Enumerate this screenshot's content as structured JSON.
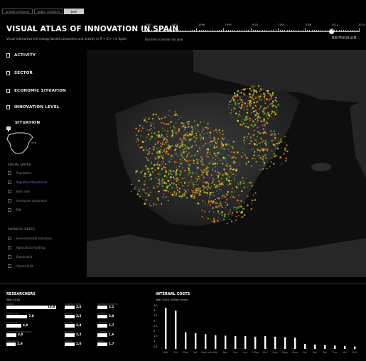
{
  "toggles": [
    {
      "label": "private company",
      "active": false
    },
    {
      "label": "public company",
      "active": false
    },
    {
      "label": "both",
      "active": true
    }
  ],
  "header": {
    "title": "VISUAL ATLAS OF INNOVATION IN SPAIN",
    "subtitle": "Visual interactive technology-based companies and activity in R + D + i in Spain"
  },
  "timeline": {
    "years": [
      "1990",
      "1993",
      "1996",
      "1999",
      "2002",
      "2005",
      "2008",
      "2011",
      "2014"
    ],
    "caption": "Business creation by year",
    "play_label": "REPRODUIR",
    "current_year": "2011"
  },
  "sidebar": {
    "categories": [
      {
        "label": "ACTIVITY",
        "icon": "checkbox-icon"
      },
      {
        "label": "SECTOR",
        "icon": "checkbox-icon"
      },
      {
        "label": "ECONOMIC SITUATION",
        "icon": "checkbox-icon"
      },
      {
        "label": "INNOVATION LEVEL",
        "icon": "checkbox-icon"
      },
      {
        "label": "SITUATION",
        "icon": "pin-icon"
      }
    ],
    "social_title": "SOCIAL DATES",
    "social": [
      "Population",
      "Migration Movements",
      "Birth rate",
      "Immigrant population",
      "PIB"
    ],
    "social_active": "Migration Movements",
    "physical_title": "PHYSICAL DATES",
    "physical": [
      "Environmental indicators",
      "Agricultural holdings",
      "Roads built",
      "Aljams built"
    ]
  },
  "researchers": {
    "title": "RESEARCHERS",
    "subtitle": "Year 2016",
    "col1": [
      {
        "name": "Madrid",
        "value": "18,8",
        "fraction": 1.0
      },
      {
        "name": "Catalunya",
        "value": "7,8",
        "fraction": 0.42
      },
      {
        "name": "Andalucia",
        "value": "4,0",
        "fraction": 0.3
      },
      {
        "name": "Comunitat Valenciana",
        "value": "3,0",
        "fraction": 0.2
      },
      {
        "name": "Pais Vasco",
        "value": "2,9",
        "fraction": 0.19
      }
    ],
    "col2": [
      {
        "name": "Castilla y León",
        "value": "2,6"
      },
      {
        "name": "Galicia",
        "value": "2,5"
      },
      {
        "name": "Aragón",
        "value": "2,4"
      },
      {
        "name": "Navarra",
        "value": "2,2"
      },
      {
        "name": "Murcia",
        "value": "2,0"
      }
    ],
    "col3": [
      {
        "name": "Castilla la Mancha",
        "value": "2,1"
      },
      {
        "name": "Asturias",
        "value": "2,0"
      },
      {
        "name": "Canarias",
        "value": "1,7"
      },
      {
        "name": "Cantabria",
        "value": "1,6"
      },
      {
        "name": "Rioja",
        "value": "1,7"
      }
    ]
  },
  "chart_data": {
    "type": "bar",
    "title": "INTERNAL COSTS",
    "subtitle": "Year 2016.  Million euros",
    "ylim": [
      0,
      4.5
    ],
    "yticks": [
      "4,5",
      "4",
      "3,5",
      "3",
      "2,5",
      "2",
      "1,5",
      "1",
      "0,5"
    ],
    "categories": [
      "Mad",
      "Cat",
      "P.Vas",
      "Val",
      "Cast.León",
      "And",
      "Nav",
      "Gal",
      "Ara",
      "C.Man",
      "Mur",
      "Cant",
      "Rioja",
      "Cana",
      "Ext",
      "Ast",
      "Bal",
      "Ceu",
      "Mel",
      "Ext2"
    ],
    "values": [
      4.2,
      3.9,
      1.7,
      1.6,
      1.5,
      1.4,
      1.35,
      1.3,
      1.3,
      1.25,
      1.3,
      1.25,
      1.2,
      1.15,
      0.5,
      0.45,
      0.4,
      0.35,
      0.3,
      0.25
    ]
  },
  "colors": {
    "background": "#000000",
    "accent_active": "#6f7fb8",
    "dot_yellow": "#e3d22a",
    "dot_orange": "#e08a1e",
    "dot_green": "#3fa52d"
  }
}
